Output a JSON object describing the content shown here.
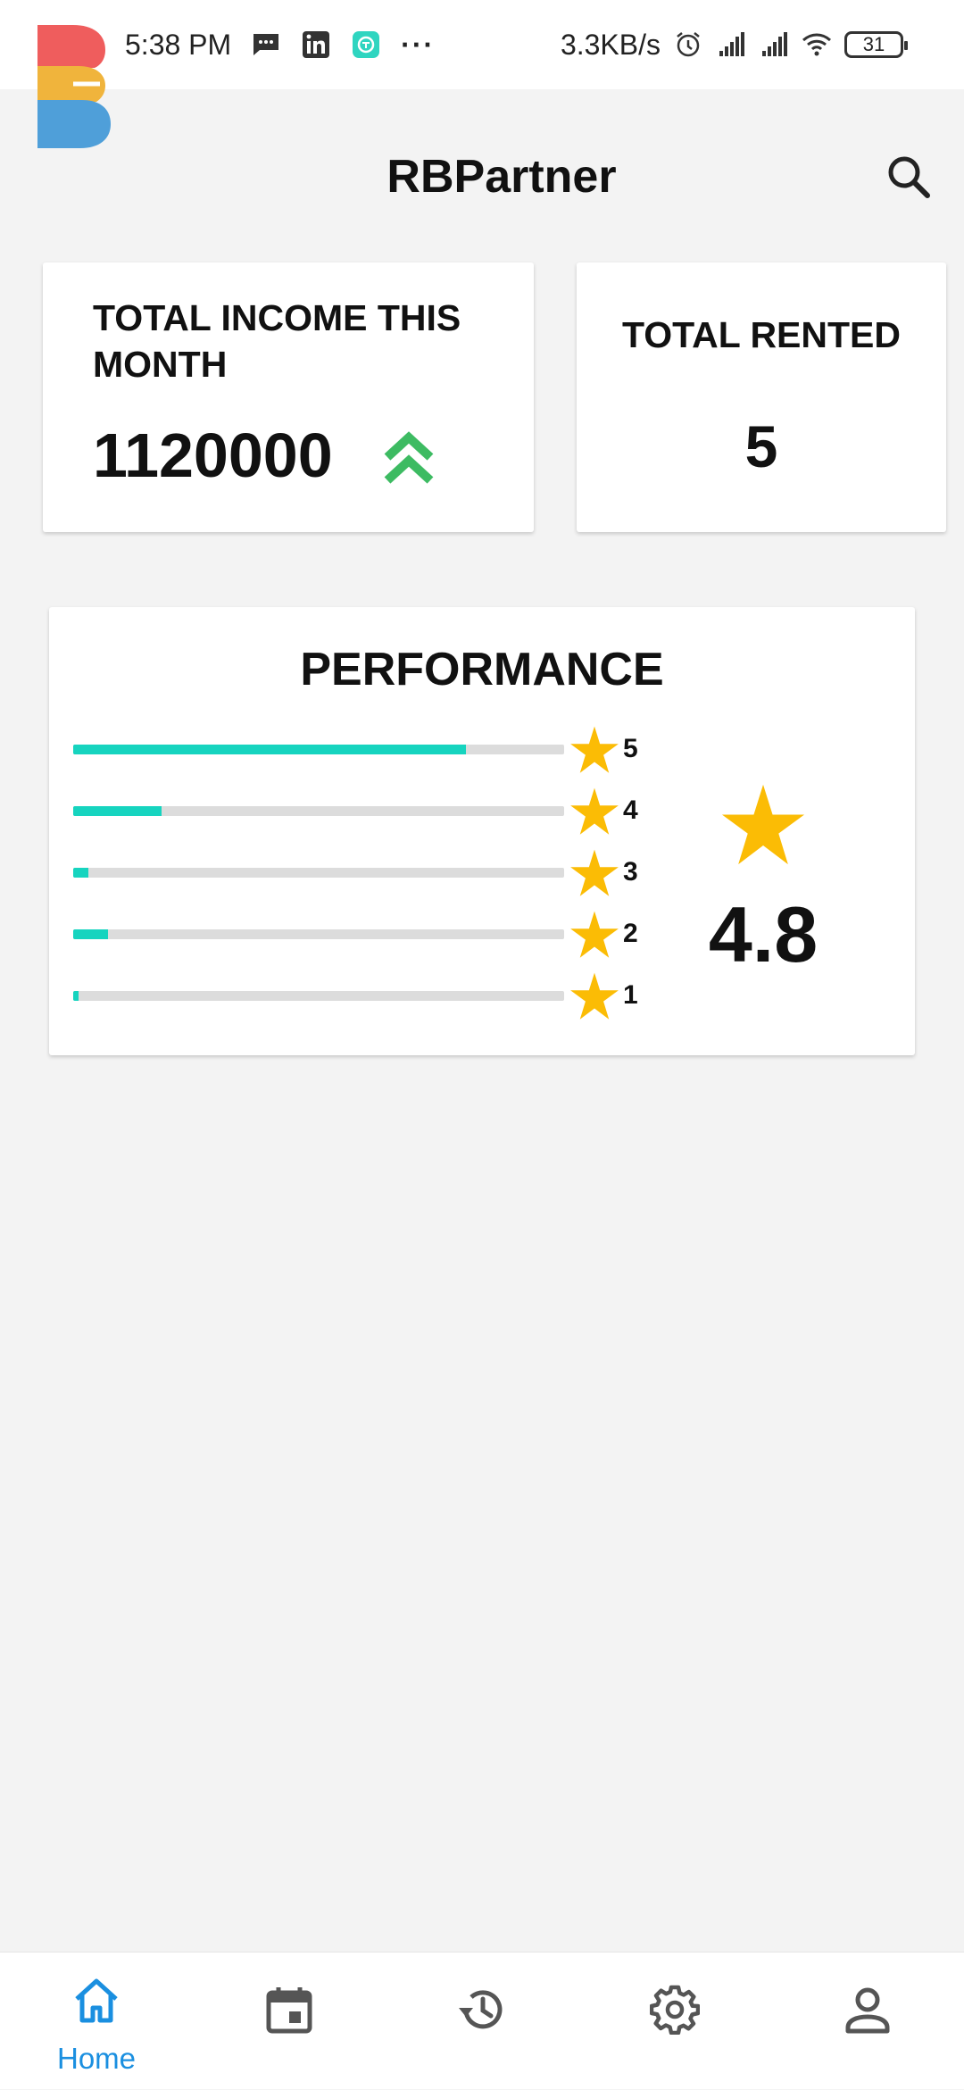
{
  "status_bar": {
    "time": "5:38 PM",
    "notification_icons": [
      "message-icon",
      "linkedin-icon",
      "app-icon"
    ],
    "more": "···",
    "network_speed": "3.3KB/s",
    "status_icons": [
      "alarm-icon",
      "signal-icon",
      "signal-icon",
      "wifi-icon"
    ],
    "battery": "31"
  },
  "header": {
    "title": "RBPartner",
    "search_icon": "search-icon",
    "logo_colors": [
      "#ef5d5d",
      "#f0b43c",
      "#4f9fd9"
    ]
  },
  "income_card": {
    "label": "TOTAL INCOME THIS MONTH",
    "value": "1120000",
    "trend_icon": "double-chevron-up-icon",
    "trend_color": "#3dbb62"
  },
  "rented_card": {
    "label": "TOTAL RENTED",
    "value": "5"
  },
  "performance": {
    "title": "PERFORMANCE",
    "average": "4.8",
    "bar_color": "#16d4bf",
    "star_color": "#fbbc05",
    "ratings": [
      {
        "stars": "5",
        "fraction": 0.8
      },
      {
        "stars": "4",
        "fraction": 0.18
      },
      {
        "stars": "3",
        "fraction": 0.03
      },
      {
        "stars": "2",
        "fraction": 0.07
      },
      {
        "stars": "1",
        "fraction": 0.01
      }
    ]
  },
  "bottom_nav": {
    "items": [
      {
        "icon": "home-icon",
        "label": "Home",
        "active": true
      },
      {
        "icon": "calendar-icon",
        "label": "",
        "active": false
      },
      {
        "icon": "history-icon",
        "label": "",
        "active": false
      },
      {
        "icon": "gear-icon",
        "label": "",
        "active": false
      },
      {
        "icon": "profile-icon",
        "label": "",
        "active": false
      }
    ],
    "active_color": "#1a8fe0",
    "inactive_color": "#555555"
  }
}
